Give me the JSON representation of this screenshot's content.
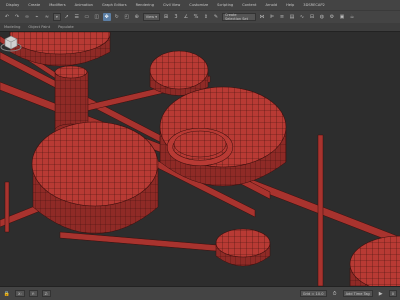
{
  "menu": [
    "Display",
    "Create",
    "Modifiers",
    "Animation",
    "Graph Editors",
    "Rendering",
    "Civil View",
    "Customize",
    "Scripting",
    "Content",
    "Arnold",
    "Help",
    "3DSRECAP2"
  ],
  "toolbar": {
    "view_dropdown": "View",
    "selection_set_dropdown": "Create Selection Set",
    "buttons": [
      "undo-icon",
      "redo-icon",
      "link-icon",
      "unlink-icon",
      "bind-icon",
      "select-icon",
      "select-by-name-icon",
      "rect-select-icon",
      "window-crossing-icon",
      "move-icon",
      "rotate-icon",
      "scale-icon",
      "place-icon",
      "pivot-icon",
      "snap-icon",
      "angle-snap-icon",
      "percent-snap-icon",
      "spinner-snap-icon",
      "edit-named-icon",
      "mirror-icon",
      "align-icon",
      "layer-icon",
      "graphite-icon",
      "curve-editor-icon",
      "schematic-icon",
      "material-editor-icon",
      "render-setup-icon",
      "render-frame-icon",
      "render-icon"
    ]
  },
  "ribbon": [
    "Modeling",
    "Object Paint",
    "Populate"
  ],
  "viewport": {
    "colors": {
      "object": "#b83a34",
      "object_dark": "#7e2320",
      "wire": "#3d0f0d",
      "background": "#2d2d2d"
    }
  },
  "status": {
    "grid": "Grid = 10.0",
    "add_time_tag": "Add Time Tag",
    "frame": "0"
  }
}
